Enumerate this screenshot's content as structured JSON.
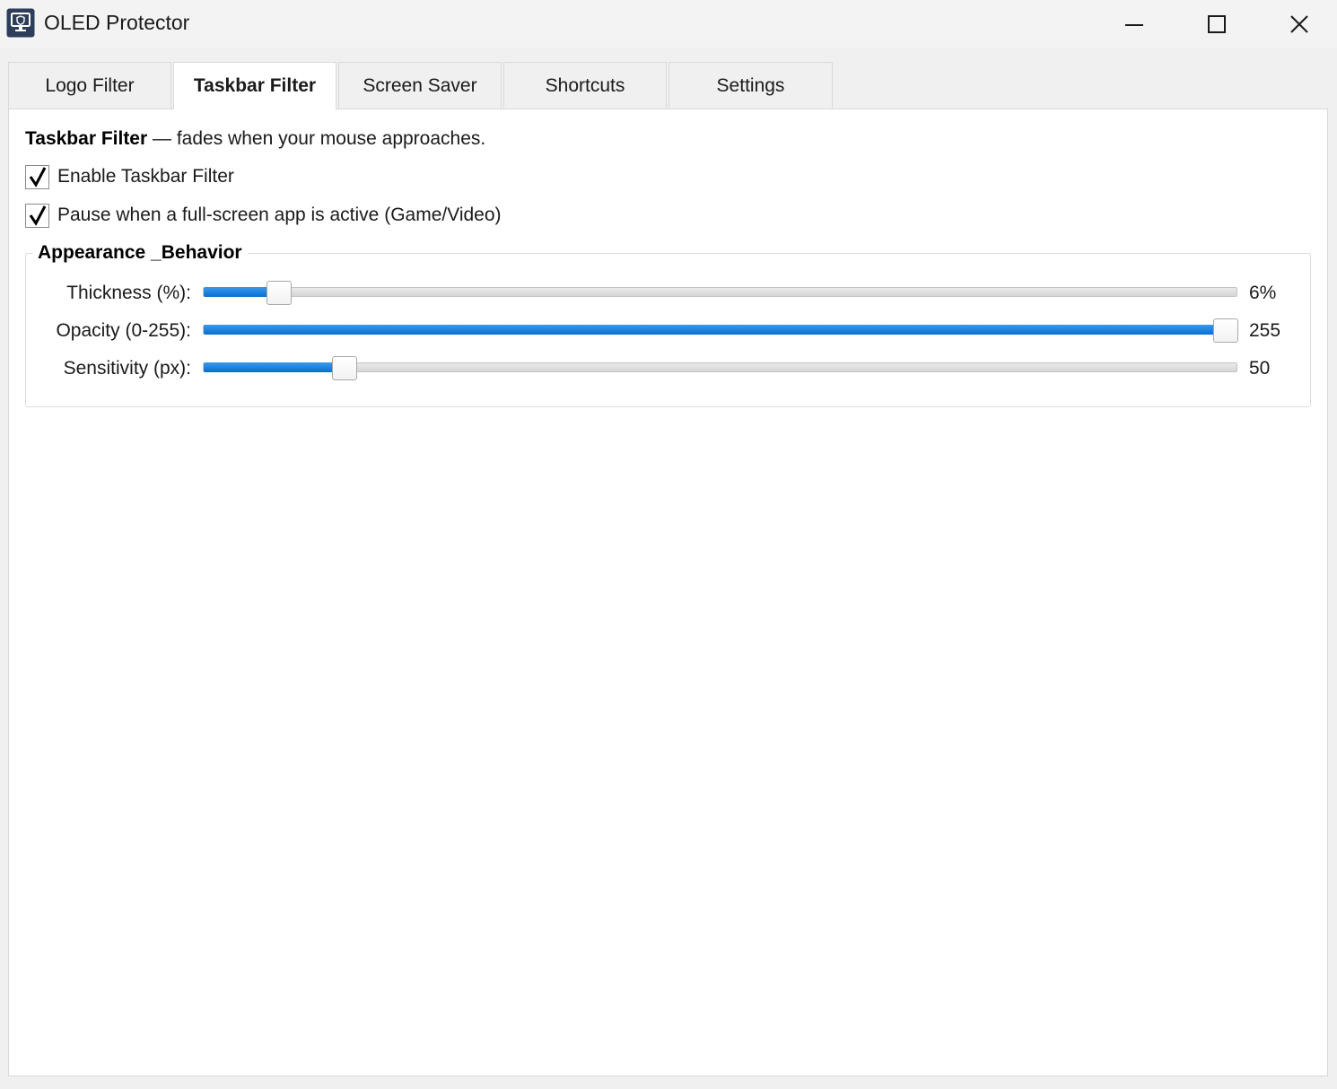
{
  "window": {
    "title": "OLED Protector",
    "icon": "monitor-shield-icon"
  },
  "tabs": [
    {
      "label": "Logo Filter",
      "active": false
    },
    {
      "label": "Taskbar Filter",
      "active": true
    },
    {
      "label": "Screen Saver",
      "active": false
    },
    {
      "label": "Shortcuts",
      "active": false
    },
    {
      "label": "Settings",
      "active": false
    }
  ],
  "taskbar_filter": {
    "intro_bold": "Taskbar Filter",
    "intro_rest": " — fades when your mouse approaches.",
    "checkboxes": [
      {
        "label": "Enable Taskbar Filter",
        "checked": true
      },
      {
        "label": "Pause when a full-screen app is active (Game/Video)",
        "checked": true
      }
    ],
    "group": {
      "title": "Appearance _Behavior",
      "sliders": [
        {
          "label": "Thickness (%):",
          "value_text": "6%",
          "fraction": 0.062
        },
        {
          "label": "Opacity (0-255):",
          "value_text": "255",
          "fraction": 1.0
        },
        {
          "label": "Sensitivity (px):",
          "value_text": "50",
          "fraction": 0.127
        }
      ]
    }
  },
  "colors": {
    "accent": "#0a6fd0",
    "panel_bg": "#ffffff",
    "window_bg": "#f0f0f0"
  }
}
